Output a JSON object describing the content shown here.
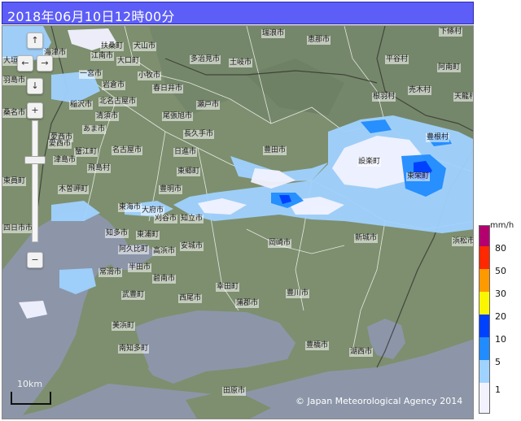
{
  "title": "2018年06月10日12時00分",
  "nav": {
    "up_icon": "arrow-up-icon",
    "down_icon": "arrow-down-icon",
    "left_icon": "arrow-left-icon",
    "right_icon": "arrow-right-icon",
    "zoom_in_icon": "plus-icon",
    "zoom_out_icon": "minus-icon"
  },
  "scale": {
    "label": "10km"
  },
  "copyright": "© Japan Meteorological Agency 2014",
  "legend": {
    "unit": "mm/h",
    "levels": [
      {
        "label": "80",
        "color": "#b4006e"
      },
      {
        "label": "50",
        "color": "#ff2800"
      },
      {
        "label": "30",
        "color": "#ff9900"
      },
      {
        "label": "20",
        "color": "#faf500"
      },
      {
        "label": "10",
        "color": "#0041ff"
      },
      {
        "label": "5",
        "color": "#218cff"
      },
      {
        "label": "1",
        "color": "#a0d2ff"
      },
      {
        "label": "",
        "color": "#f2f2ff"
      }
    ]
  },
  "colors": {
    "land": "#7d8f6e",
    "sea": "#8c96a8",
    "boundary": "#ffffff",
    "title_bar": "#5d5df7",
    "rain_light": "#a0d2ff",
    "rain_moderate": "#218cff",
    "rain_heavy": "#0041ff"
  },
  "places": [
    {
      "name": "瑞浪市"
    },
    {
      "name": "恵那市"
    },
    {
      "name": "下條村"
    },
    {
      "name": "扶桑町"
    },
    {
      "name": "犬山市"
    },
    {
      "name": "江南市"
    },
    {
      "name": "大口町"
    },
    {
      "name": "多治見市"
    },
    {
      "name": "土岐市"
    },
    {
      "name": "平谷村"
    },
    {
      "name": "阿南町"
    },
    {
      "name": "岩倉市"
    },
    {
      "name": "小牧市"
    },
    {
      "name": "売木村"
    },
    {
      "name": "天龍村"
    },
    {
      "name": "北名古屋市"
    },
    {
      "name": "春日井市"
    },
    {
      "name": "根羽村"
    },
    {
      "name": "稲沢市"
    },
    {
      "name": "清須市"
    },
    {
      "name": "瀬戸市"
    },
    {
      "name": "愛西市"
    },
    {
      "name": "あま市"
    },
    {
      "name": "尾張旭市"
    },
    {
      "name": "長久手市"
    },
    {
      "name": "蟹江町"
    },
    {
      "name": "名古屋市"
    },
    {
      "name": "日進市"
    },
    {
      "name": "豊根村"
    },
    {
      "name": "豊田市"
    },
    {
      "name": "設楽町"
    },
    {
      "name": "飛島村"
    },
    {
      "name": "東郷町"
    },
    {
      "name": "東栄町"
    },
    {
      "name": "木曽岬町"
    },
    {
      "name": "豊明市"
    },
    {
      "name": "東海市"
    },
    {
      "name": "大府市"
    },
    {
      "name": "刈谷市"
    },
    {
      "name": "知立市"
    },
    {
      "name": "知多市"
    },
    {
      "name": "東浦町"
    },
    {
      "name": "新城市"
    },
    {
      "name": "浜松市"
    },
    {
      "name": "阿久比町"
    },
    {
      "name": "高浜市"
    },
    {
      "name": "安城市"
    },
    {
      "name": "岡崎市"
    },
    {
      "name": "半田市"
    },
    {
      "name": "常滑市"
    },
    {
      "name": "碧南市"
    },
    {
      "name": "武豊町"
    },
    {
      "name": "西尾市"
    },
    {
      "name": "幸田町"
    },
    {
      "name": "豊川市"
    },
    {
      "name": "蒲郡市"
    },
    {
      "name": "美浜町"
    },
    {
      "name": "南知多町"
    },
    {
      "name": "豊橋市"
    },
    {
      "name": "湖西市"
    },
    {
      "name": "田原市"
    },
    {
      "name": "海津市"
    },
    {
      "name": "桑名市"
    },
    {
      "name": "四日市市"
    },
    {
      "name": "大垣市"
    },
    {
      "name": "羽島市"
    },
    {
      "name": "一宮市"
    },
    {
      "name": "東員町"
    },
    {
      "name": "愛西市"
    },
    {
      "name": "津島市"
    }
  ]
}
